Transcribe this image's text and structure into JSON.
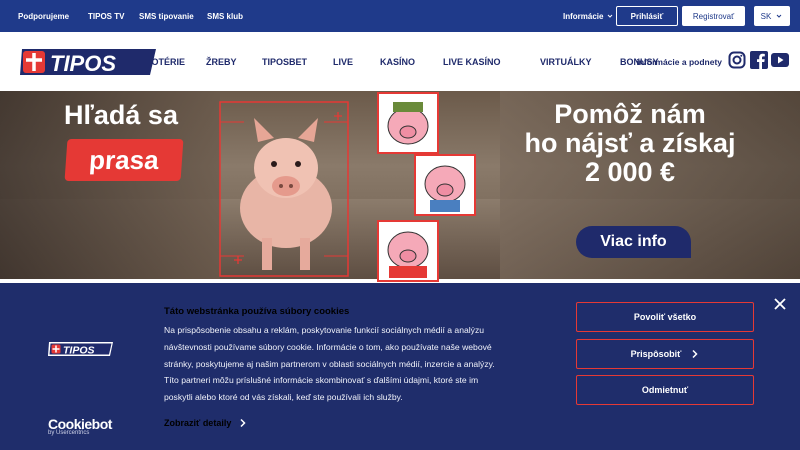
{
  "topbar": {
    "links": [
      "Podporujeme",
      "TIPOS TV",
      "SMS tipovanie",
      "SMS klub"
    ],
    "info": "Informácie",
    "login": "Prihlásiť",
    "register": "Registrovať",
    "lang": "SK"
  },
  "nav": {
    "items": [
      "LOTÉRIE",
      "ŽREBY",
      "TIPOSBET",
      "LIVE",
      "KASÍNO",
      "LIVE KASÍNO",
      "VIRTUÁLKY",
      "BONUSY"
    ],
    "overlay": "Pomoc, sťažnosti, informácie a podnety"
  },
  "brand": {
    "name": "TIPOS",
    "red": "#e53935",
    "blue": "#1f3a8a",
    "navy": "#1f2d6b"
  },
  "hero": {
    "left_line1": "Hľadá sa",
    "left_line2": "prasa",
    "right_line1": "Pomôž nám",
    "right_line2": "ho nájsť a získaj",
    "right_line3": "2 000 €",
    "cta": "Viac info"
  },
  "cookie": {
    "title": "Táto webstránka používa súbory cookies",
    "lines": [
      "Na prispôsobenie obsahu a reklám, poskytovanie funkcií sociálnych médií a analýzu",
      "návštevnosti používame súbory cookie. Informácie o tom, ako používate naše webové",
      "stránky, poskytujeme aj našim partnerom v oblasti sociálnych médií, inzercie a analýzy.",
      "Títo partneri môžu príslušné informácie skombinovať s ďalšími údajmi, ktoré ste im",
      "poskytli alebo ktoré od vás získali, keď ste používali ich služby."
    ],
    "details": "Zobraziť detaily",
    "allow_all": "Povoliť všetko",
    "customize": "Prispôsobiť",
    "deny": "Odmietnuť",
    "cookiebot_brand": "Cookiebot",
    "cookiebot_sub": "by Usercentrics"
  },
  "icons": {
    "close": "close-icon",
    "chevron": "chevron-right-icon",
    "caret": "chevron-down-icon",
    "instagram": "instagram-icon",
    "facebook": "facebook-icon",
    "youtube": "youtube-icon"
  }
}
